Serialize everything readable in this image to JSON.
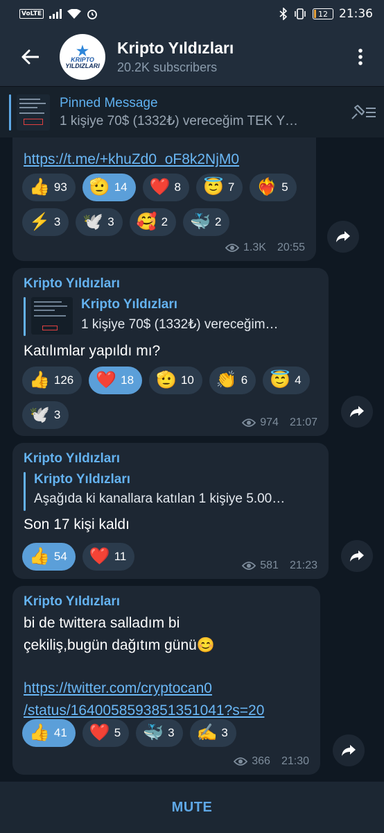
{
  "status_bar": {
    "volte": "VoLTE",
    "battery": "12",
    "time": "21:36"
  },
  "header": {
    "avatar_line1": "KRIPTO",
    "avatar_line2": "YILDIZLARI",
    "title": "Kripto Yıldızları",
    "subtitle": "20.2K subscribers"
  },
  "pinned": {
    "title": "Pinned Message",
    "text": "1 kişiye 70$ (1332₺) vereceğim   TEK Y…"
  },
  "messages": [
    {
      "link": "https://t.me/+khuZd0_oF8k2NjM0",
      "reactions": [
        {
          "emoji": "👍",
          "count": "93",
          "active": false
        },
        {
          "emoji": "🫡",
          "count": "14",
          "active": true
        },
        {
          "emoji": "❤️",
          "count": "8",
          "active": false
        },
        {
          "emoji": "😇",
          "count": "7",
          "active": false
        },
        {
          "emoji": "❤️‍🔥",
          "count": "5",
          "active": false
        },
        {
          "emoji": "⚡",
          "count": "3",
          "active": false
        },
        {
          "emoji": "🕊️",
          "count": "3",
          "active": false
        },
        {
          "emoji": "🥰",
          "count": "2",
          "active": false
        },
        {
          "emoji": "🐳",
          "count": "2",
          "active": false
        }
      ],
      "views": "1.3K",
      "time": "20:55"
    },
    {
      "author": "Kripto Yıldızları",
      "reply_author": "Kripto Yıldızları",
      "reply_text": "1 kişiye 70$ (1332₺) vereceğim…",
      "text": "Katılımlar yapıldı mı?",
      "reactions": [
        {
          "emoji": "👍",
          "count": "126",
          "active": false
        },
        {
          "emoji": "❤️",
          "count": "18",
          "active": true
        },
        {
          "emoji": "🫡",
          "count": "10",
          "active": false
        },
        {
          "emoji": "👏",
          "count": "6",
          "active": false
        },
        {
          "emoji": "😇",
          "count": "4",
          "active": false
        },
        {
          "emoji": "🕊️",
          "count": "3",
          "active": false
        }
      ],
      "views": "974",
      "time": "21:07"
    },
    {
      "author": "Kripto Yıldızları",
      "reply_author": "Kripto Yıldızları",
      "reply_text": "Aşağıda ki kanallara katılan 1 kişiye 5.00…",
      "text": "Son 17 kişi kaldı",
      "reactions": [
        {
          "emoji": "👍",
          "count": "54",
          "active": true
        },
        {
          "emoji": "❤️",
          "count": "11",
          "active": false
        }
      ],
      "views": "581",
      "time": "21:23"
    },
    {
      "author": "Kripto Yıldızları",
      "text_line1": "bi de twittera salladım bi",
      "text_line2": "çekiliş,bugün dağıtım günü😊",
      "link_line1": "https://twitter.com/cryptocan0",
      "link_line2": "/status/1640058593851351041?s=20",
      "reactions": [
        {
          "emoji": "👍",
          "count": "41",
          "active": true
        },
        {
          "emoji": "❤️",
          "count": "5",
          "active": false
        },
        {
          "emoji": "🐳",
          "count": "3",
          "active": false
        },
        {
          "emoji": "✍️",
          "count": "3",
          "active": false
        }
      ],
      "views": "366",
      "time": "21:30"
    }
  ],
  "bottom": {
    "mute_label": "MUTE"
  },
  "colors": {
    "accent": "#5fa8e6",
    "active_chip": "#5b9fd9",
    "chip": "#2b3b4c",
    "bubble": "#1d2733"
  }
}
